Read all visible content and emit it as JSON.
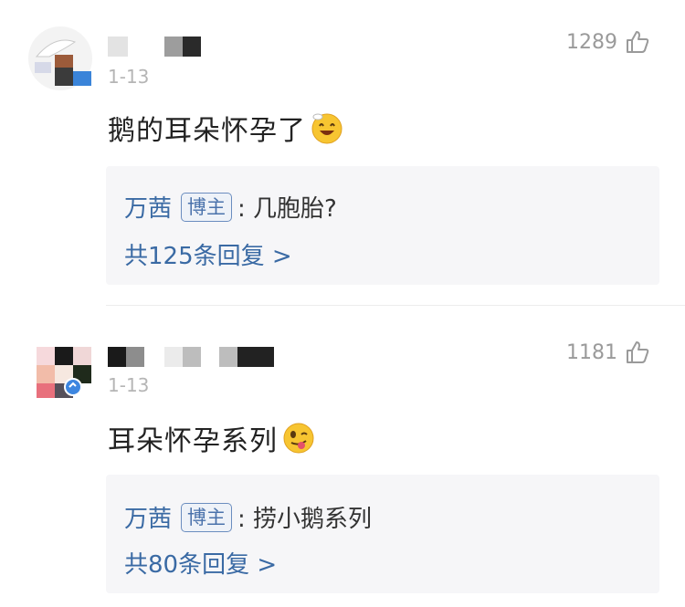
{
  "comments": [
    {
      "date": "1-13",
      "likes": "1289",
      "text": "鹅的耳朵怀孕了",
      "emoji": "smiling-face-emoji",
      "reply": {
        "author": "万茜",
        "badge": "博主",
        "content": ": 几胞胎?",
        "count": "共125条回复 >"
      }
    },
    {
      "date": "1-13",
      "likes": "1181",
      "text": "耳朵怀孕系列",
      "emoji": "tongue-face-emoji",
      "reply": {
        "author": "万茜",
        "badge": "博主",
        "content": ": 捞小鹅系列",
        "count": "共80条回复 >"
      }
    }
  ],
  "colors": {
    "link": "#3a6aa4",
    "reply_bg": "#f6f6f8",
    "meta": "#9a9a9a"
  }
}
